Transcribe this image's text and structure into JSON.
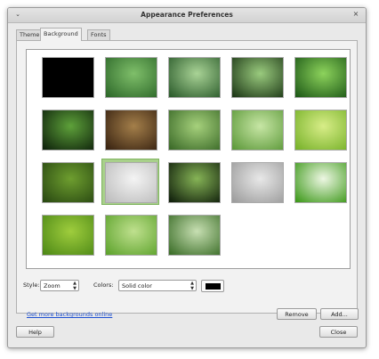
{
  "window": {
    "title": "Appearance Preferences",
    "menu_glyph": "⌄",
    "close_glyph": "×"
  },
  "tabs": [
    {
      "label": "Theme",
      "active": false
    },
    {
      "label": "Background",
      "active": true
    },
    {
      "label": "Fonts",
      "active": false
    }
  ],
  "backgrounds": [
    {
      "name": "black",
      "colors": [
        "#000000",
        "#000000"
      ]
    },
    {
      "name": "green-leaf-drops",
      "colors": [
        "#7fbf6a",
        "#2f6a2b"
      ]
    },
    {
      "name": "water-drop-leaf",
      "colors": [
        "#a9d396",
        "#2d5d2d"
      ]
    },
    {
      "name": "twig-drop",
      "colors": [
        "#9acb7e",
        "#1f3a18"
      ]
    },
    {
      "name": "green-grass-blades",
      "colors": [
        "#8dd35c",
        "#1f5b18"
      ]
    },
    {
      "name": "fern",
      "colors": [
        "#5ea13a",
        "#0f240c"
      ]
    },
    {
      "name": "stones-water",
      "colors": [
        "#a47f4a",
        "#3a2412"
      ]
    },
    {
      "name": "green-bokeh-dark",
      "colors": [
        "#a6d17c",
        "#3c6b29"
      ]
    },
    {
      "name": "green-bubbles",
      "colors": [
        "#c7e6a5",
        "#5e9a3b"
      ]
    },
    {
      "name": "green-glow",
      "colors": [
        "#d8ed88",
        "#79b32b"
      ]
    },
    {
      "name": "dark-green-gradient",
      "colors": [
        "#6e9e2f",
        "#2a4a12"
      ]
    },
    {
      "name": "logo-gray",
      "colors": [
        "#f4f4f4",
        "#bdbdbd"
      ]
    },
    {
      "name": "dark-green-center",
      "colors": [
        "#86b456",
        "#11200c"
      ]
    },
    {
      "name": "logo-gray-dark",
      "colors": [
        "#e8e8e8",
        "#9d9d9d"
      ]
    },
    {
      "name": "fresh-grass",
      "colors": [
        "#eef7e4",
        "#3f9a1c"
      ]
    },
    {
      "name": "green-texture",
      "colors": [
        "#9fcd3d",
        "#4f8a17"
      ]
    },
    {
      "name": "green-light-bokeh",
      "colors": [
        "#bfe08e",
        "#5fa42e"
      ]
    },
    {
      "name": "green-vertical-streaks",
      "colors": [
        "#c7dfb2",
        "#3d6f2a"
      ]
    }
  ],
  "selected_background": 11,
  "style": {
    "label": "Style:",
    "value": "Zoom"
  },
  "colors": {
    "label": "Colors:",
    "value": "Solid color",
    "swatch": "#000000"
  },
  "link": "Get more backgrounds online",
  "buttons": {
    "remove": "Remove",
    "add": "Add...",
    "help": "Help",
    "close": "Close"
  }
}
